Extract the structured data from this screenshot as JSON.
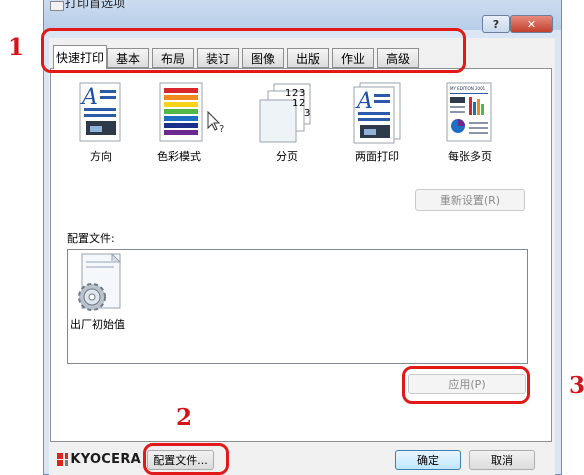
{
  "window": {
    "title": "打印首选项",
    "help_label": "?",
    "close_label": "✕"
  },
  "tabs": [
    {
      "label": "快速打印"
    },
    {
      "label": "基本"
    },
    {
      "label": "布局"
    },
    {
      "label": "装订"
    },
    {
      "label": "图像"
    },
    {
      "label": "出版"
    },
    {
      "label": "作业"
    },
    {
      "label": "高级"
    }
  ],
  "features": [
    {
      "label": "方向",
      "icon": "orientation-icon"
    },
    {
      "label": "色彩模式",
      "icon": "color-mode-icon"
    },
    {
      "label": "分页",
      "icon": "collate-icon"
    },
    {
      "label": "两面打印",
      "icon": "duplex-icon"
    },
    {
      "label": "每张多页",
      "icon": "multiple-pages-icon"
    }
  ],
  "collate_numbers": {
    "a": "1",
    "b": "2",
    "c": "3"
  },
  "newsletter_header": "MY EDITION  2001",
  "reset_button": "重新设置(R)",
  "profiles": {
    "label": "配置文件:",
    "items": [
      {
        "label": "出厂初始值",
        "icon": "gear-document-icon"
      }
    ]
  },
  "apply_button": "应用(P)",
  "footer": {
    "brand": "KYOCERA",
    "profile_button": "配置文件...",
    "ok_button": "确定",
    "cancel_button": "取消"
  },
  "annotations": {
    "n1": "1",
    "n2": "2",
    "n3": "3"
  },
  "colors": {
    "annotation": "#e21919",
    "window_frame": "#dbe6f4",
    "brand_red": "#d9261c"
  }
}
